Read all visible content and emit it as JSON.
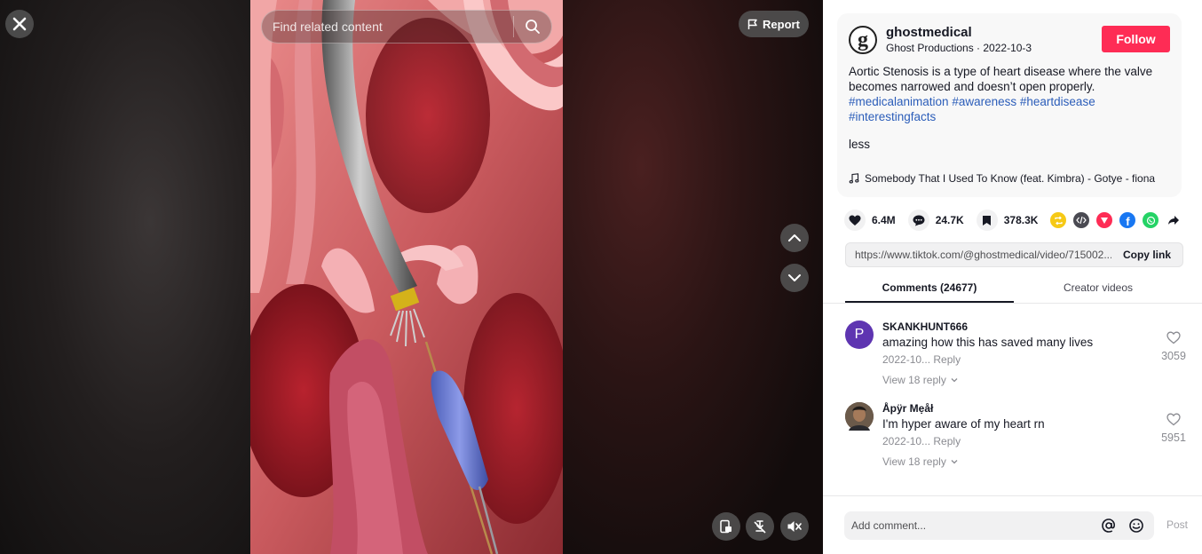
{
  "search": {
    "placeholder": "Find related content"
  },
  "report": {
    "label": "Report"
  },
  "author": {
    "username": "ghostmedical",
    "subtitle": "Ghost Productions · 2022-10-3",
    "follow_label": "Follow"
  },
  "description": {
    "text": "Aortic Stenosis is a type of heart disease where the valve becomes narrowed and doesn’t open properly.",
    "tags": [
      "#medicalanimation",
      "#awareness",
      "#heartdisease",
      "#interestingfacts"
    ],
    "less_label": "less",
    "music": "Somebody That I Used To Know (feat. Kimbra) - Gotye - fiona"
  },
  "stats": {
    "likes": "6.4M",
    "comments": "24.7K",
    "saves": "378.3K"
  },
  "share_icons": [
    "repost-icon",
    "embed-icon",
    "send-icon",
    "facebook-icon",
    "whatsapp-icon",
    "share-arrow-icon"
  ],
  "link": {
    "url": "https://www.tiktok.com/@ghostmedical/video/715002...",
    "copy_label": "Copy link"
  },
  "tabs": [
    {
      "label": "Comments (24677)",
      "active": true
    },
    {
      "label": "Creator videos",
      "active": false
    }
  ],
  "comments": [
    {
      "avatar_letter": "P",
      "avatar_color": "#5e35b1",
      "user": "SKANKHUNT666",
      "text": "amazing how this has saved many lives",
      "date": "2022-10...",
      "reply_label": "Reply",
      "view_replies": "View 18 reply",
      "likes": "3059"
    },
    {
      "avatar_letter": "",
      "avatar_color": "#4a3a30",
      "user": "Åpÿr Mẹåł",
      "text": "I'm hyper aware of my heart rn",
      "date": "2022-10...",
      "reply_label": "Reply",
      "view_replies": "View 18 reply",
      "likes": "5951"
    }
  ],
  "comment_input": {
    "placeholder": "Add comment...",
    "post_label": "Post"
  },
  "colors": {
    "accent": "#fe2c55",
    "hashtag": "#2b5db9"
  }
}
